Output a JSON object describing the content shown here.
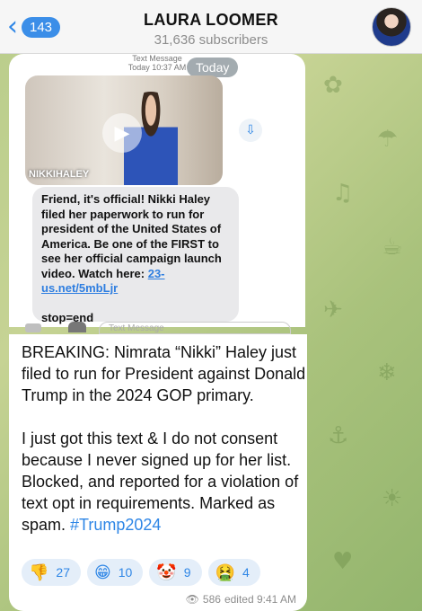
{
  "header": {
    "back_count": "143",
    "channel_title": "LAURA LOOMER",
    "subscribers": "31,636 subscribers"
  },
  "screenshot": {
    "meta_line1": "Text Message",
    "meta_line2": "Today 10:37 AM",
    "date_pill": "Today",
    "video_brand": "NIKKIHALEY",
    "sms_text": "Friend, it's official! Nikki Haley filed her paperwork to run for president of the United States of America. Be one of the FIRST to see her official campaign launch video. Watch here: ",
    "sms_link": "23-us.net/5mbLjr",
    "sms_stop": "stop=end",
    "input_placeholder": "Text Message"
  },
  "post": {
    "text": "BREAKING: Nimrata “Nikki” Haley just filed to run for President against Donald Trump in the 2024 GOP primary.\n\nI just got this text & I do not consent because I never signed up for her list. Blocked, and reported for a violation of text opt in requirements. Marked as spam. ",
    "hashtag": "#Trump2024",
    "reactions": [
      {
        "emoji": "👎",
        "count": "27"
      },
      {
        "emoji": "😁",
        "count": "10"
      },
      {
        "emoji": "🤡",
        "count": "9"
      },
      {
        "emoji": "🤮",
        "count": "4"
      }
    ],
    "views": "586",
    "edited_time": "edited 9:41 AM"
  },
  "icons": {
    "back": "chevron-left-icon",
    "play": "play-icon",
    "download": "download-icon",
    "views": "eye-icon"
  },
  "colors": {
    "accent": "#2e86e6",
    "reaction_bg": "#e4eef9",
    "header_bg": "#f6f6f6"
  }
}
